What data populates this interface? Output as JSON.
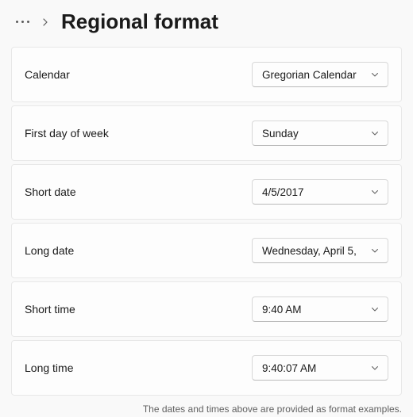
{
  "header": {
    "title": "Regional format"
  },
  "settings": [
    {
      "label": "Calendar",
      "value": "Gregorian Calendar"
    },
    {
      "label": "First day of week",
      "value": "Sunday"
    },
    {
      "label": "Short date",
      "value": "4/5/2017"
    },
    {
      "label": "Long date",
      "value": "Wednesday, April 5,"
    },
    {
      "label": "Short time",
      "value": "9:40 AM"
    },
    {
      "label": "Long time",
      "value": "9:40:07 AM"
    }
  ],
  "footnote": "The dates and times above are provided as format examples."
}
